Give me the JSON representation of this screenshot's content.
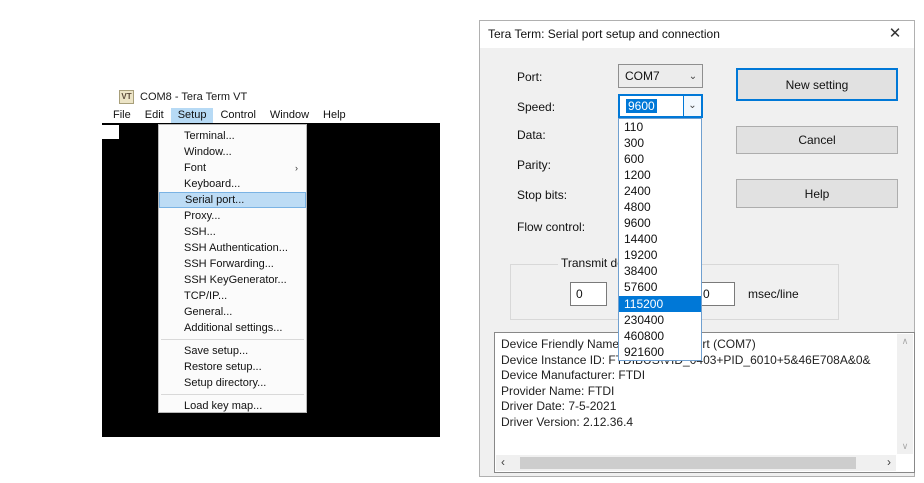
{
  "left_window": {
    "icon_text": "VT",
    "title": "COM8 - Tera Term VT",
    "menu_bar": [
      "File",
      "Edit",
      "Setup",
      "Control",
      "Window",
      "Help"
    ],
    "active_menu": "Setup",
    "setup_menu": {
      "items": [
        {
          "label": "Terminal..."
        },
        {
          "label": "Window..."
        },
        {
          "label": "Font",
          "submenu": true
        },
        {
          "label": "Keyboard..."
        },
        {
          "label": "Serial port...",
          "highlighted": true
        },
        {
          "label": "Proxy..."
        },
        {
          "label": "SSH..."
        },
        {
          "label": "SSH Authentication..."
        },
        {
          "label": "SSH Forwarding..."
        },
        {
          "label": "SSH KeyGenerator..."
        },
        {
          "label": "TCP/IP..."
        },
        {
          "label": "General..."
        },
        {
          "label": "Additional settings...",
          "sep_after": true
        },
        {
          "label": "Save setup..."
        },
        {
          "label": "Restore setup..."
        },
        {
          "label": "Setup directory...",
          "sep_after": true
        },
        {
          "label": "Load key map..."
        }
      ]
    }
  },
  "dialog": {
    "title": "Tera Term: Serial port setup and connection",
    "close_glyph": "✕",
    "fields": {
      "port_label": "Port:",
      "port_value": "COM7",
      "speed_label": "Speed:",
      "speed_value": "9600",
      "data_label": "Data:",
      "parity_label": "Parity:",
      "stopbits_label": "Stop bits:",
      "flow_label": "Flow control:"
    },
    "chevron_glyph": "⌄",
    "speed_options": [
      "110",
      "300",
      "600",
      "1200",
      "2400",
      "4800",
      "9600",
      "14400",
      "19200",
      "38400",
      "57600",
      "115200",
      "230400",
      "460800",
      "921600"
    ],
    "selected_speed": "115200",
    "buttons": {
      "new_setting": "New setting",
      "cancel": "Cancel",
      "help": "Help"
    },
    "transmit": {
      "group_label": "Transmit delay",
      "delay_per_char": "0",
      "delay_per_line": "0",
      "unit_line": "msec/line"
    },
    "device_info": {
      "lines": [
        "Device Friendly Name: USB Serial Port (COM7)",
        "Device Instance ID: FTDIBUS\\VID_0403+PID_6010+5&46E708A&0&",
        "Device Manufacturer: FTDI",
        "Provider Name: FTDI",
        "Driver Date: 7-5-2021",
        "Driver Version: 2.12.36.4"
      ],
      "scroll_up_glyph": "∧",
      "scroll_down_glyph": "∨",
      "scroll_left_glyph": "‹",
      "scroll_right_glyph": "›"
    }
  },
  "colors": {
    "accent": "#0078d7",
    "menu_highlight": "#bddcf5",
    "menubar_highlight": "#b7daf5",
    "terminal_bg": "#000000"
  }
}
